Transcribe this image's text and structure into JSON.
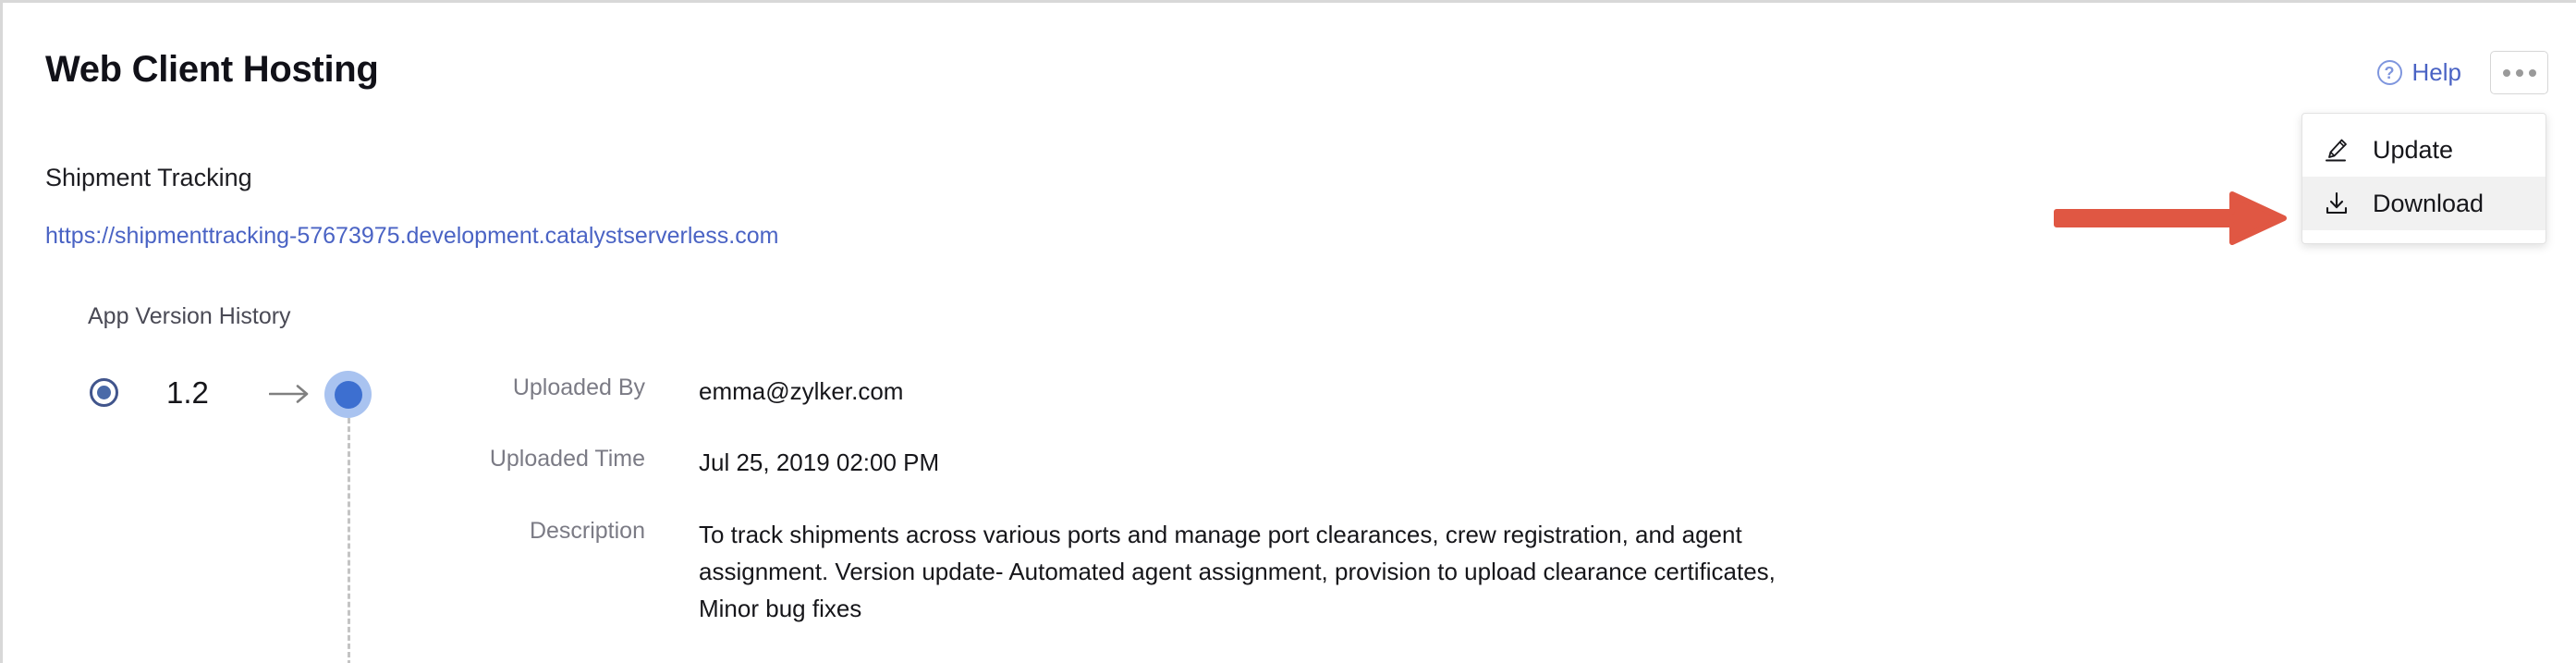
{
  "header": {
    "title": "Web Client Hosting",
    "help_label": "Help",
    "help_icon": "question-circle-icon",
    "more_icon": "ellipsis-icon"
  },
  "dropdown": {
    "visible": true,
    "items": [
      {
        "label": "Update",
        "icon": "pencil-edit-icon",
        "highlighted": false
      },
      {
        "label": "Download",
        "icon": "download-icon",
        "highlighted": true
      }
    ]
  },
  "annotation": {
    "type": "arrow",
    "direction": "right",
    "color": "#e05743",
    "points_to": "Download"
  },
  "app": {
    "name": "Shipment Tracking",
    "url": "https://shipmenttracking-57673975.development.catalystserverless.com"
  },
  "version_history": {
    "section_label": "App Version History",
    "selected_version": "1.2",
    "arrow_icon": "arrow-right-icon",
    "radio_icon": "radio-selected-icon",
    "timeline_node_icon": "timeline-dot-icon",
    "details": [
      {
        "label": "Uploaded By",
        "value": "emma@zylker.com"
      },
      {
        "label": "Uploaded Time",
        "value": "Jul 25, 2019 02:00 PM"
      },
      {
        "label": "Description",
        "value": "To track shipments across various ports and manage port clearances, crew registration, and agent assignment. Version update- Automated agent assignment, provision to upload clearance certificates, Minor bug fixes"
      }
    ]
  },
  "colors": {
    "link": "#4a63c4",
    "accent_blue": "#3d6fd0",
    "annotation_red": "#e05743",
    "menu_highlight": "#f1f1f1",
    "muted_text": "#7b7b85"
  }
}
